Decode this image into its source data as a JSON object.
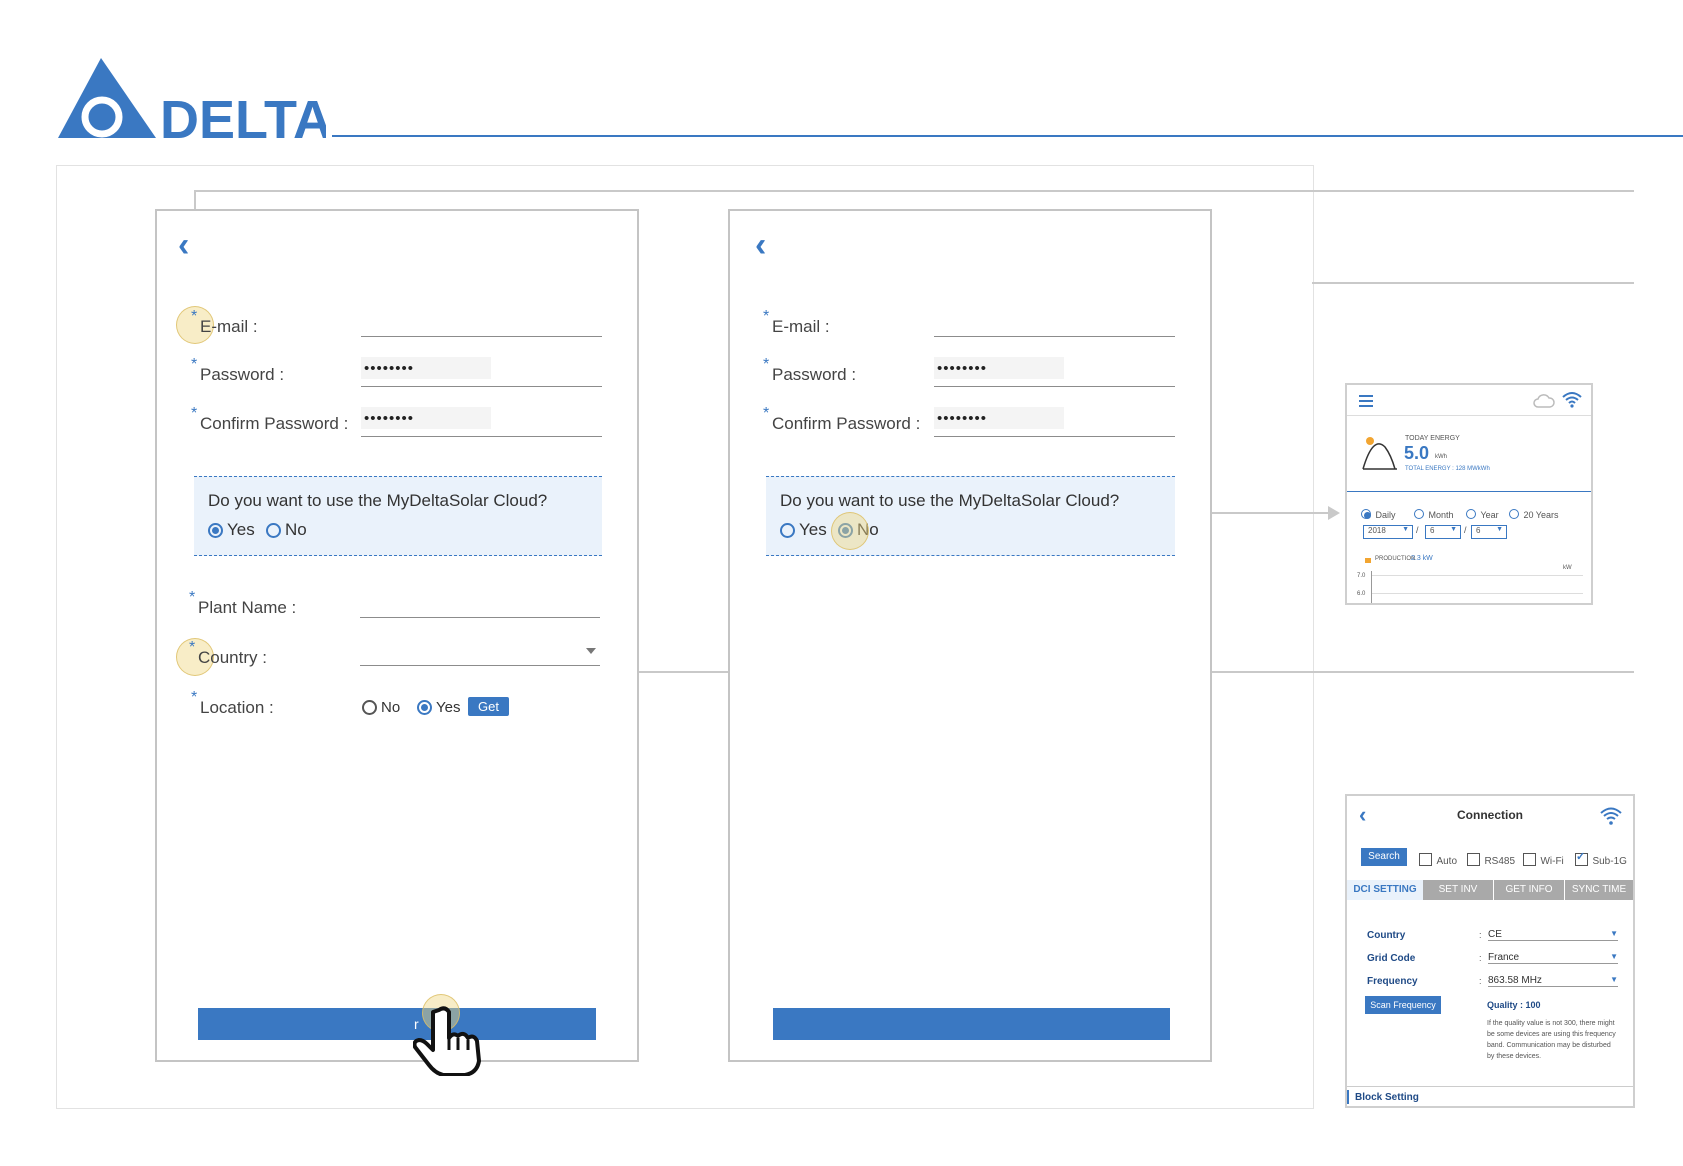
{
  "colors": {
    "accent": "#3a78c2",
    "highlight": "#f0d782",
    "border": "#c4c4c4"
  },
  "brand": {
    "name": "DELTA"
  },
  "form": {
    "email_label": "E-mail :",
    "password_label": "Password :",
    "confirm_label": "Confirm Password  :",
    "password_mask": "••••••••",
    "cloud_question": "Do you want to use the MyDeltaSolar Cloud?",
    "yes": "Yes",
    "no": "No",
    "plant_label": "Plant Name  :",
    "country_label": "Country :",
    "location_label": "Location :",
    "get_label": "Get",
    "submit_partial": "r"
  },
  "overview": {
    "today_label": "TODAY ENERGY",
    "today_value": "5.0",
    "today_unit": "kWh",
    "total_label": "TOTAL ENERGY : 128 MWkWh",
    "periods": [
      "Daily",
      "Month",
      "Year",
      "20 Years"
    ],
    "selected_period": "Daily",
    "date": {
      "year": "2018",
      "month": "6",
      "day": "6"
    },
    "production_label": "PRODUCTION",
    "production_value": "2.3 kW",
    "unit_kw": "kW",
    "y1": "7.0",
    "y2": "6.0"
  },
  "connection": {
    "title": "Connection",
    "search": "Search",
    "options": [
      {
        "label": "Auto",
        "checked": false
      },
      {
        "label": "RS485",
        "checked": false
      },
      {
        "label": "Wi-Fi",
        "checked": false
      },
      {
        "label": "Sub-1G",
        "checked": true
      }
    ],
    "tabs": [
      "DCI SETTING",
      "SET INV",
      "GET INFO",
      "SYNC TIME"
    ],
    "rows": [
      {
        "label": "Country",
        "value": "CE"
      },
      {
        "label": "Grid Code",
        "value": "France"
      },
      {
        "label": "Frequency",
        "value": "863.58 MHz"
      }
    ],
    "scan": "Scan Frequency",
    "quality": "Quality : 100",
    "note": "If the quality value is not 300, there might be some devices are using this frequency band. Communication may be disturbed by these devices.",
    "block": "Block Setting"
  }
}
